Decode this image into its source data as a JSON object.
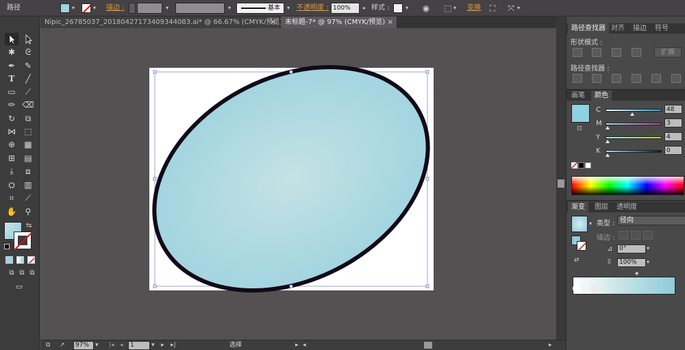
{
  "control_bar": {
    "selection_label": "路径",
    "fill_color": "#9dd4e0",
    "stroke_label": "描边 :",
    "stroke_weight": "",
    "stroke_style_label": "基本",
    "opacity_label": "不透明度 :",
    "opacity_value": "100%",
    "style_label": "样式 :",
    "transform_label": "变换"
  },
  "tabs": [
    {
      "label": "Nipic_26785037_20180427173409344083.ai* @ 66.67% (CMYK/预览)",
      "close": "×"
    },
    {
      "label": "未标题-7* @ 97% (CMYK/预览)",
      "close": "×"
    }
  ],
  "tools": {
    "selection_icon": "arrow-icon",
    "fill_swatch_color": "#9dd4e0"
  },
  "canvas": {
    "ellipse_fill_center": "#c4e2e4",
    "ellipse_fill_edge": "#9fd3df",
    "ellipse_stroke": "#120a16"
  },
  "status_bar": {
    "zoom": "97%",
    "page": "1",
    "tool_status": "选择"
  },
  "pathfinder_panel": {
    "tabs": [
      "路径查找器",
      "对齐",
      "描边",
      "符号"
    ],
    "shape_modes_label": "形状模式 :",
    "expand_label": "扩展",
    "pathfinders_label": "路径查找器 :"
  },
  "color_panel": {
    "tabs": [
      "画笔",
      "颜色"
    ],
    "swatch_color": "#8fd0e2",
    "channels": [
      {
        "name": "C",
        "value": "48"
      },
      {
        "name": "M",
        "value": "3"
      },
      {
        "name": "Y",
        "value": "4"
      },
      {
        "name": "K",
        "value": "0"
      }
    ]
  },
  "gradient_panel": {
    "tabs": [
      "渐变",
      "图层",
      "透明度"
    ],
    "type_label": "类型 :",
    "type_value": "径向",
    "stroke_label": "描边 :",
    "angle_value": "0°",
    "aspect_value": "100%"
  }
}
